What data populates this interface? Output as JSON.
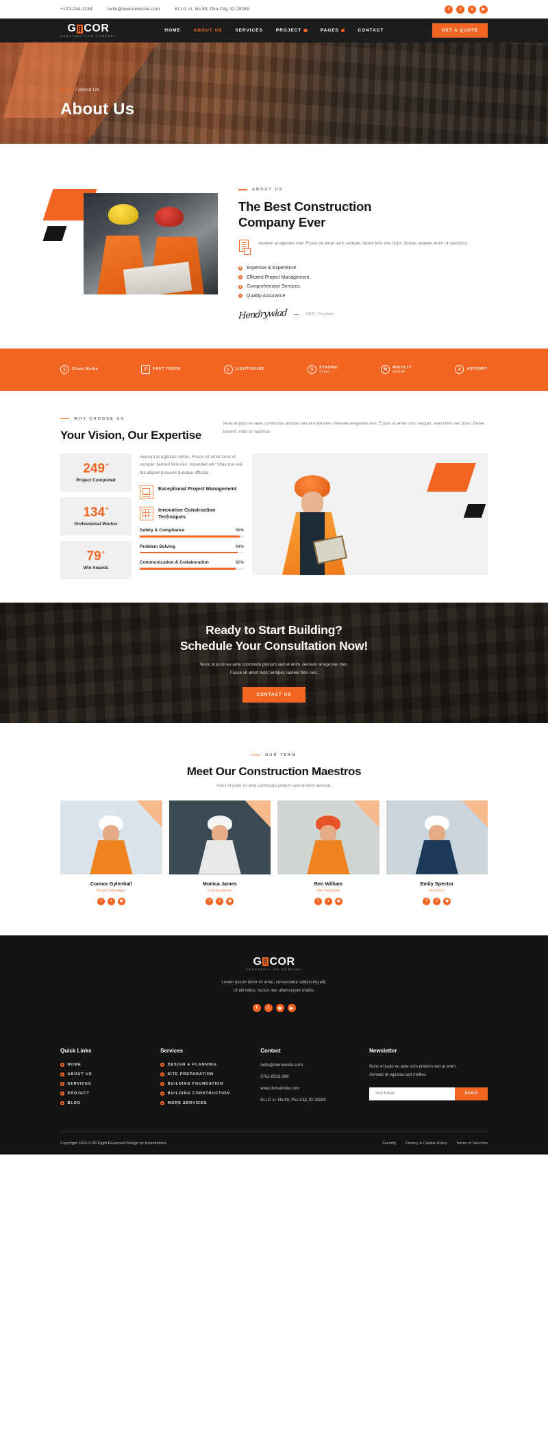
{
  "topbar": {
    "phone": "+123-234-1234",
    "email": "hello@awesomesite.com",
    "address": "KLLG st. No.99, Pku City, ID 28289",
    "social": [
      {
        "name": "facebook-icon",
        "glyph": "f"
      },
      {
        "name": "twitter-icon",
        "glyph": "t"
      },
      {
        "name": "x-icon",
        "glyph": "x"
      },
      {
        "name": "youtube-icon",
        "glyph": "▶"
      }
    ]
  },
  "nav": {
    "logo_main": "G",
    "logo_main2": "COR",
    "logo_sub": "CONSTRUCTION COMPANY",
    "items": [
      {
        "label": "HOME",
        "active": false,
        "badge": false
      },
      {
        "label": "ABOUT US",
        "active": true,
        "badge": false
      },
      {
        "label": "SERVICES",
        "active": false,
        "badge": false
      },
      {
        "label": "PROJECT",
        "active": false,
        "badge": true
      },
      {
        "label": "PAGES",
        "active": false,
        "badge": true
      },
      {
        "label": "CONTACT",
        "active": false,
        "badge": false
      }
    ],
    "quote_button": "GET A QUOTE"
  },
  "hero": {
    "breadcrumb_home": "Home",
    "breadcrumb_sep": " / ",
    "breadcrumb_current": "About Us",
    "title": "About Us"
  },
  "about": {
    "eyebrow": "ABOUT US",
    "heading_line1": "The Best Construction",
    "heading_line2": "Company Ever",
    "description": "Aenean at egestas met. Fusce sit amet nunc semper, laoret felis nec dolor. Donec laoreet, enim ut maximus.",
    "features": [
      "Expertise & Experience",
      "Efficient Project Management",
      "Comprehensive Services",
      "Quality Assurance"
    ],
    "signature": "Hendrywlad",
    "signature_role": "CEO / Founder"
  },
  "clients": [
    {
      "name": "Clans Media",
      "sub": "",
      "mark": "C"
    },
    {
      "name": "FAST TRUCK",
      "sub": "",
      "mark": "F"
    },
    {
      "name": "LIGHTHOUSE",
      "sub": "",
      "mark": "L"
    },
    {
      "name": "STRONG",
      "sub": "STEAL",
      "mark": "S"
    },
    {
      "name": "MIKOLLY",
      "sub": "GROUP",
      "mark": "M"
    },
    {
      "name": "ASTORRY",
      "sub": "",
      "mark": "A"
    }
  ],
  "why": {
    "eyebrow": "WHY CHOOSE US",
    "heading": "Your Vision, Our Expertise",
    "intro": "Nunc et justo eu ante commodos pretium sed at enim bren. Aenean at egestas met. Fusce sit amet nunc semper, laoret felis nec dolor. Donec laoreet, enim ut maximus.",
    "body": "Aenean at egestas metus. Fusce sit amet nunc et semper, laoreet felis nec, imperdiet elit. Vitae dui sed dui aliquet posuere quisque efficitur.",
    "stats": [
      {
        "value": "249",
        "suffix": "+",
        "label": "Project Completed"
      },
      {
        "value": "134",
        "suffix": "+",
        "label": "Professional Worker"
      },
      {
        "value": "79",
        "suffix": "+",
        "label": "Win Awards"
      }
    ],
    "items": [
      {
        "title": "Exceptional Project Management",
        "icon": "document-icon"
      },
      {
        "title": "Innovative Construction Techniques",
        "icon": "blueprint-icon"
      }
    ],
    "bars": [
      {
        "name": "Safety & Compliance",
        "pct": "96%",
        "value": 96
      },
      {
        "name": "Problem Solving",
        "pct": "94%",
        "value": 94
      },
      {
        "name": "Communication & Collaboration",
        "pct": "92%",
        "value": 92
      }
    ]
  },
  "cta": {
    "heading_line1": "Ready to Start Building?",
    "heading_line2": "Schedule Your Consultation Now!",
    "paragraph_line1": "Nunc et justo eu ante commodo pretium sed at enim. Aenean at egestas met.",
    "paragraph_line2": "Fusce sit amet nunc semper, laoreet felis nec.",
    "button": "CONTACT US"
  },
  "team": {
    "eyebrow": "OUR TEAM",
    "heading": "Meet Our Construction Maestros",
    "subtitle": "Nunc et justo eu ante commodo pretium sed at enim aenean.",
    "members": [
      {
        "name": "Connor Gylenhall",
        "role": "Project Manager",
        "helmet": "#ffffff",
        "vest": "#f0821f",
        "bg": "#d9e4ec"
      },
      {
        "name": "Monica James",
        "role": "Civil Engineer",
        "helmet": "#f5f5f5",
        "vest": "#e8e8e8",
        "bg": "#3a4a52"
      },
      {
        "name": "Ben William",
        "role": "Site Manager",
        "helmet": "#e8532a",
        "vest": "#f0821f",
        "bg": "#cfd6d2"
      },
      {
        "name": "Emily Spector",
        "role": "Architect",
        "helmet": "#ffffff",
        "vest": "#1d3a5c",
        "bg": "#c9d4dd"
      }
    ],
    "social": [
      {
        "name": "facebook-icon",
        "glyph": "f"
      },
      {
        "name": "twitter-icon",
        "glyph": "t"
      },
      {
        "name": "instagram-icon",
        "glyph": "◉"
      }
    ]
  },
  "footer": {
    "logo_main": "G",
    "logo_main2": "COR",
    "logo_sub": "CONSTRUCTION COMPANY",
    "tagline_line1": "Lorem ipsum dolor sit amet, consectetur adipiscing elit.",
    "tagline_line2": "Ut elit tellus, luctus nec ullamcorper mattis.",
    "social": [
      {
        "name": "facebook-icon",
        "glyph": "f"
      },
      {
        "name": "twitter-icon",
        "glyph": "t"
      },
      {
        "name": "instagram-icon",
        "glyph": "◉"
      },
      {
        "name": "youtube-icon",
        "glyph": "▶"
      }
    ],
    "quick_links_title": "Quick Links",
    "quick_links": [
      "HOME",
      "ABOUT US",
      "SERVICES",
      "PROJECT",
      "BLOG"
    ],
    "services_title": "Services",
    "services": [
      "DESIGN & PLANNING",
      "SITE PREPARATION",
      "BUILDING FOUNDATION",
      "BUILDING CONSTRUCTION",
      "MORE SERVICES"
    ],
    "contact_title": "Contact",
    "contact": [
      "hello@domainsite.com",
      "0761-8523-398",
      "www.domainsite.com",
      "KLLG st. No.99, Pku City, ID 28289"
    ],
    "newsletter_title": "Newsletter",
    "newsletter_text_line1": "Nunc et justo eu ante com pretium sed at enim.",
    "newsletter_text_line2": "Aenean at egestas sed mellus.",
    "newsletter_placeholder": "Your Email",
    "newsletter_button": "SEND",
    "copyright": "Copyright 2024 © All Right Reserved Design by Romotheme",
    "legal": [
      "Security",
      "Privacy & Cookie Policy",
      "Terms of Services"
    ]
  }
}
